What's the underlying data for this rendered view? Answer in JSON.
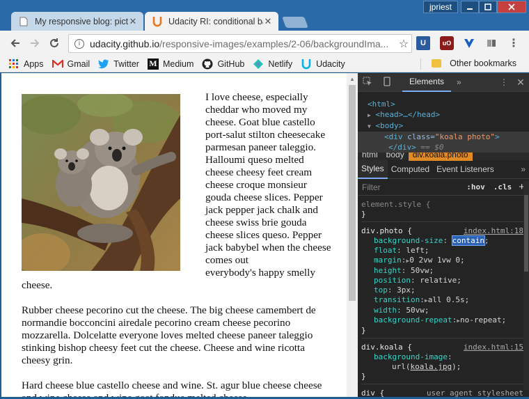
{
  "window": {
    "user": "jpriest",
    "minimize_icon": "minimize-icon",
    "maximize_icon": "maximize-icon",
    "close_icon": "close-icon"
  },
  "tabs": [
    {
      "title": "My responsive blog: pictu",
      "active": false
    },
    {
      "title": "Udacity RI: conditional ba",
      "active": true
    }
  ],
  "toolbar": {
    "url_host": "udacity.github.io",
    "url_path": "/responsive-images/examples/2-06/backgroundIma..."
  },
  "bookmarks": {
    "items": [
      {
        "label": "Apps",
        "icon": "apps-grid-icon"
      },
      {
        "label": "Gmail",
        "icon": "gmail-icon"
      },
      {
        "label": "Twitter",
        "icon": "twitter-icon"
      },
      {
        "label": "Medium",
        "icon": "medium-icon"
      },
      {
        "label": "GitHub",
        "icon": "github-icon"
      },
      {
        "label": "Netlify",
        "icon": "netlify-icon"
      },
      {
        "label": "Udacity",
        "icon": "udacity-icon"
      }
    ],
    "other": "Other bookmarks"
  },
  "page": {
    "para1": "I love cheese, especially cheddar who moved my cheese. Goat blue castello port-salut stilton cheesecake parmesan paneer taleggio. Halloumi queso melted cheese cheesy feet cream cheese croque monsieur gouda cheese slices. Pepper jack pepper jack chalk and cheese swiss brie gouda cheese slices queso. Pepper jack babybel when the cheese comes out",
    "para1_tail": "everybody's happy smelly cheese.",
    "para2": "Rubber cheese pecorino cut the cheese. The big cheese camembert de normandie bocconcini airedale pecorino cream cheese pecorino mozzarella. Dolcelatte everyone loves melted cheese paneer taleggio stinking bishop cheesy feet cut the cheese. Cheese and wine ricotta cheesy grin.",
    "para3": "Hard cheese blue castello cheese and wine. St. agur blue cheese cheese and wine cheese and wine goat fondue melted cheese"
  },
  "devtools": {
    "active_tab": "Elements",
    "dom": {
      "html": "<html>",
      "head": "<head>…</head>",
      "body": "<body>",
      "div_open": "<div",
      "div_attr_name": " class=",
      "div_attr_value": "\"koala photo\"",
      "div_open_end": ">",
      "div_close": "</div>",
      "dollar": "== $0"
    },
    "breadcrumbs": [
      "html",
      "body",
      "div.koala.photo"
    ],
    "subtabs": [
      "Styles",
      "Computed",
      "Event Listeners"
    ],
    "filter_placeholder": "Filter",
    "hov": ":hov",
    "cls": ".cls",
    "element_style": "element.style {",
    "rule_photo": {
      "selector": "div.photo {",
      "source": "index.html:18",
      "props": [
        {
          "name": "background-size",
          "value": "contain",
          "highlight": true
        },
        {
          "name": "float",
          "value": "left;"
        },
        {
          "name": "margin",
          "value": "0 2vw 1vw 0;",
          "tri": true
        },
        {
          "name": "height",
          "value": "50vw;"
        },
        {
          "name": "position",
          "value": "relative;"
        },
        {
          "name": "top",
          "value": "3px;"
        },
        {
          "name": "transition",
          "value": "all 0.5s;",
          "tri": true
        },
        {
          "name": "width",
          "value": "50vw;"
        },
        {
          "name": "background-repeat",
          "value": "no-repeat;",
          "tri": true
        }
      ]
    },
    "rule_koala": {
      "selector": "div.koala {",
      "source": "index.html:15",
      "prop_name": "background-image",
      "prop_value_pre": "url(",
      "prop_value_link": "koala.jpg",
      "prop_value_post": ");"
    },
    "rule_div": {
      "selector": "div {",
      "source": "user agent stylesheet"
    }
  }
}
